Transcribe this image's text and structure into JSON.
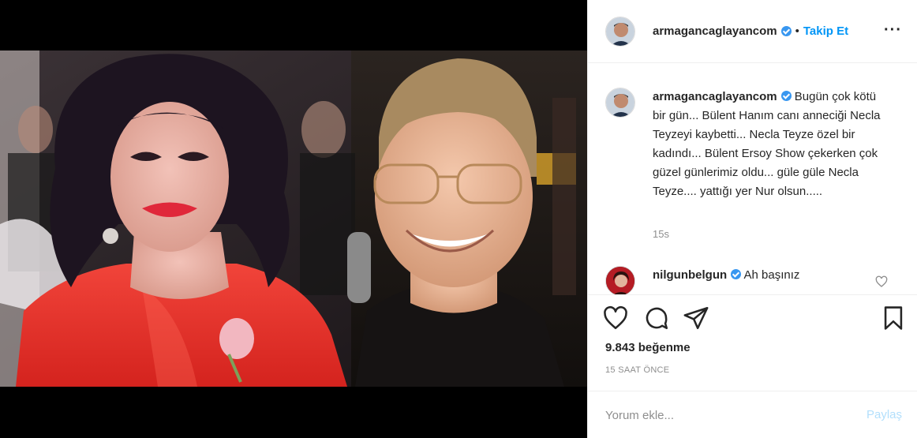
{
  "colors": {
    "accent": "#0095f6",
    "verified": "#3897f0",
    "muted": "#8e8e8e",
    "post_disabled": "#b2dffc"
  },
  "post": {
    "author": "armagancaglayancom",
    "follow_label": "Takip Et",
    "more_icon": "more-horizontal-icon",
    "caption_user": "armagancaglayancom",
    "caption_text": "Bugün çok kötü bir gün... Bülent Hanım canı anneciği Necla Teyzeyi kaybetti... Necla Teyze özel bir kadındı... Bülent Ersoy Show çekerken çok güzel günlerimiz oldu... güle güle Necla Teyze.... yattığı yer Nur olsun.....",
    "caption_time": "15s",
    "reply_user": "nilgunbelgun",
    "reply_text": "Ah başınız",
    "likes": "9.843 beğenme",
    "posted_ago": "15 SAAT ÖNCE"
  },
  "icons": {
    "like": "heart-icon",
    "comment": "comment-icon",
    "share": "paper-plane-icon",
    "save": "bookmark-icon"
  },
  "composer": {
    "placeholder": "Yorum ekle...",
    "post_label": "Paylaş"
  }
}
